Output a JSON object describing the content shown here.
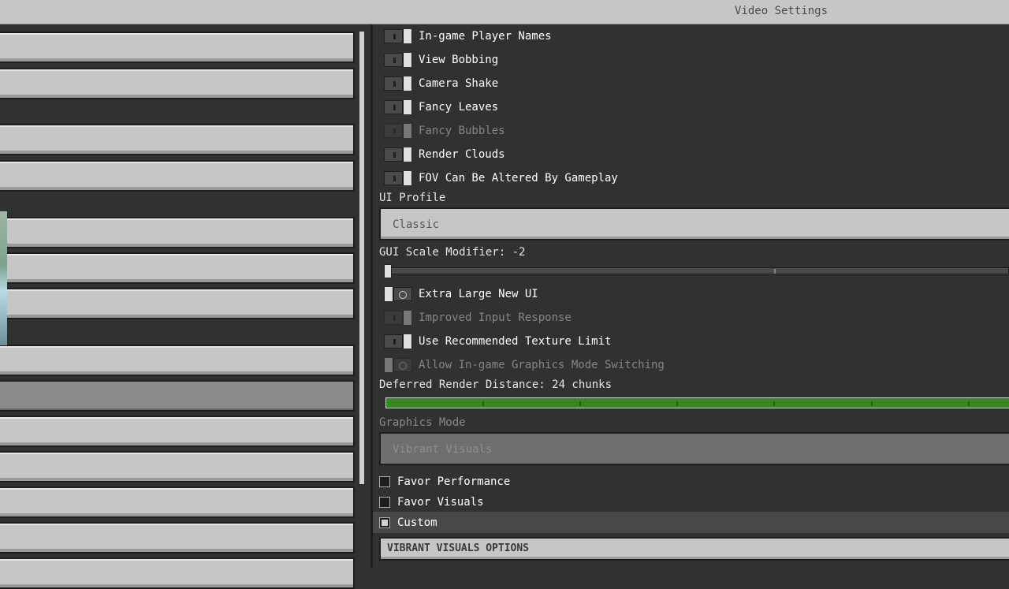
{
  "window": {
    "title": "Video Settings"
  },
  "toggles_top": [
    {
      "label": "In-game Player Names",
      "state": "on",
      "enabled": true
    },
    {
      "label": "View Bobbing",
      "state": "on",
      "enabled": true
    },
    {
      "label": "Camera Shake",
      "state": "on",
      "enabled": true
    },
    {
      "label": "Fancy Leaves",
      "state": "on",
      "enabled": true
    },
    {
      "label": "Fancy Bubbles",
      "state": "on",
      "enabled": false
    },
    {
      "label": "Render Clouds",
      "state": "on",
      "enabled": true
    },
    {
      "label": "FOV Can Be Altered By Gameplay",
      "state": "on",
      "enabled": true
    }
  ],
  "ui_profile": {
    "label": "UI Profile",
    "value": "Classic"
  },
  "gui_scale": {
    "label": "GUI Scale Modifier: -2",
    "value": -2
  },
  "toggles_mid": [
    {
      "label": "Extra Large New UI",
      "state": "off",
      "enabled": true
    },
    {
      "label": "Improved Input Response",
      "state": "on",
      "enabled": false
    },
    {
      "label": "Use Recommended Texture Limit",
      "state": "on",
      "enabled": true
    },
    {
      "label": "Allow In-game Graphics Mode Switching",
      "state": "off",
      "enabled": false
    }
  ],
  "deferred_render": {
    "label": "Deferred Render Distance: 24 chunks",
    "value": 24
  },
  "graphics_mode": {
    "label": "Graphics Mode",
    "value": "Vibrant Visuals",
    "options": [
      {
        "label": "Favor Performance",
        "checked": false
      },
      {
        "label": "Favor Visuals",
        "checked": false
      },
      {
        "label": "Custom",
        "checked": true
      }
    ]
  },
  "vibrant_options": {
    "label": "VIBRANT VISUALS OPTIONS"
  },
  "colors": {
    "accent_green": "#3c8527",
    "panel": "#313131",
    "button": "#c6c6c6"
  }
}
